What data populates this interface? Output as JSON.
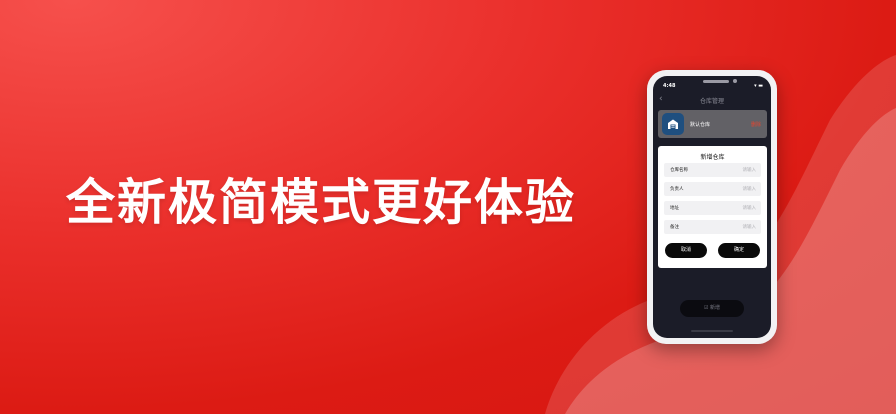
{
  "headline": "全新极简模式更好体验",
  "phone": {
    "status_time": "4:48",
    "status_icons": "▾ ▬",
    "nav_back": "‹",
    "nav_title": "仓库管理",
    "warehouse": {
      "name": "默认仓库",
      "delete_label": "删除"
    },
    "dialog": {
      "title": "新增仓库",
      "fields": [
        {
          "label": "仓库名称",
          "placeholder": "请输入"
        },
        {
          "label": "负责人",
          "placeholder": "请输入"
        },
        {
          "label": "地址",
          "placeholder": "请输入"
        },
        {
          "label": "备注",
          "placeholder": "请输入"
        }
      ],
      "cancel_label": "取消",
      "confirm_label": "确定"
    },
    "add_button_label": "☑ 新增"
  },
  "colors": {
    "background": "#e02620",
    "phone_frame": "#f2f2f4",
    "screen": "#1b1c28",
    "dialog_button": "#0a0a0a",
    "delete_text": "#e6462f"
  }
}
